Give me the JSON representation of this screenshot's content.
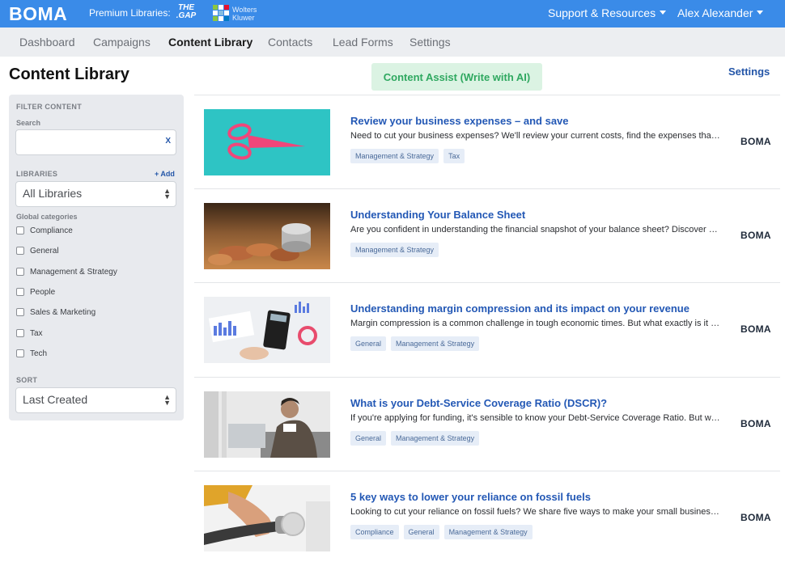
{
  "topbar": {
    "brand": "BOMA",
    "premium_label": "Premium Libraries:",
    "library_gap": "THE .GAP",
    "library_wk_line1": "Wolters",
    "library_wk_line2": "Kluwer",
    "support_label": "Support & Resources",
    "user_name": "Alex Alexander"
  },
  "nav": {
    "tabs": [
      "Dashboard",
      "Campaigns",
      "Content Library",
      "Contacts",
      "Lead Forms",
      "Settings"
    ],
    "active_tab": "Content Library"
  },
  "page": {
    "title": "Content Library",
    "assist_button": "Content Assist (Write with AI)",
    "settings_link": "Settings"
  },
  "filter": {
    "heading": "FILTER CONTENT",
    "search_label": "Search",
    "search_value": "",
    "search_clear": "X",
    "libraries_label": "LIBRARIES",
    "add_link": "+ Add",
    "libraries_value": "All Libraries",
    "categories_label": "Global categories",
    "categories": [
      "Compliance",
      "General",
      "Management & Strategy",
      "People",
      "Sales & Marketing",
      "Tax",
      "Tech"
    ],
    "sort_label": "SORT",
    "sort_value": "Last Created"
  },
  "items": [
    {
      "title": "Review your business expenses – and save",
      "description": "Need to cut your business expenses? We'll review your current costs, find the expenses that could be trimmed and help you save.",
      "tags": [
        "Management & Strategy",
        "Tax"
      ],
      "source": "BOMA",
      "thumb_icon": "scissors-image"
    },
    {
      "title": "Understanding Your Balance Sheet",
      "description": "Are you confident in understanding the financial snapshot of your balance sheet? Discover what it tells you.",
      "tags": [
        "Management & Strategy"
      ],
      "source": "BOMA",
      "thumb_icon": "coins-image"
    },
    {
      "title": "Understanding margin compression and its impact on your revenue",
      "description": "Margin compression is a common challenge in tough economic times. But what exactly is it and how does it affect you?",
      "tags": [
        "General",
        "Management & Strategy"
      ],
      "source": "BOMA",
      "thumb_icon": "calculator-image"
    },
    {
      "title": "What is your Debt-Service Coverage Ratio (DSCR)?",
      "description": "If you're applying for funding, it's sensible to know your Debt-Service Coverage Ratio. But what is it exactly?",
      "tags": [
        "General",
        "Management & Strategy"
      ],
      "source": "BOMA",
      "thumb_icon": "businessman-image"
    },
    {
      "title": "5 key ways to lower your reliance on fossil fuels",
      "description": "Looking to cut your reliance on fossil fuels? We share five ways to make your small business greener and save money.",
      "tags": [
        "Compliance",
        "General",
        "Management & Strategy"
      ],
      "source": "BOMA",
      "thumb_icon": "fuel-pump-image"
    }
  ],
  "colors": {
    "topbar": "#3a8be8",
    "link": "#2358b5",
    "assist_bg": "#dbf3e3",
    "assist_text": "#2fa860"
  }
}
